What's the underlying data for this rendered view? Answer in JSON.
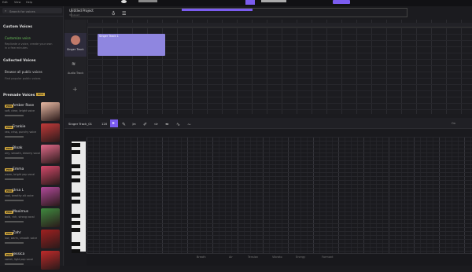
{
  "topbar": {
    "menu_items": [
      "Edit",
      "View",
      "Help"
    ],
    "project_title": "Untitled Project",
    "project_sub": "Unsaved"
  },
  "sidebar": {
    "search_placeholder": "Search for voices",
    "custom_voices": {
      "title": "Custom Voices",
      "item": "Customize voice",
      "desc_lines": [
        "Replicate a voice, create your own",
        "in a few minutes"
      ]
    },
    "collected_voices": {
      "title": "Collected Voices",
      "item": "Browse all public voices",
      "desc": "Find popular public voices"
    },
    "premade_voices": {
      "title": "Premade Voices",
      "badge": "NEW",
      "items": [
        {
          "badge": "PRO",
          "name": "Amber Rose",
          "desc": "soft, clear, bright voice",
          "color": "#e8b9a4"
        },
        {
          "badge": "PRO",
          "name": "Frankie",
          "desc": "raw, crisp, punchy voice",
          "color": "#c23a3a"
        },
        {
          "badge": "PRO",
          "name": "Bloak",
          "desc": "airy, smooth, dreamy vocal",
          "color": "#e06a8a"
        },
        {
          "badge": "PRO",
          "name": "Emma",
          "desc": "warm, bright pop vocal",
          "color": "#d4496b"
        },
        {
          "badge": "PRO",
          "name": "Ursa L",
          "desc": "cool, breathy alt voice",
          "color": "#b04a9a"
        },
        {
          "badge": "PRO",
          "name": "Maximus",
          "desc": "bold, rich, strong vocal",
          "color": "#3f8a3f"
        },
        {
          "badge": "PRO",
          "name": "Zahr",
          "desc": "low, warm, smooth voice",
          "color": "#a02020"
        },
        {
          "badge": "PRO",
          "name": "Jessica",
          "desc": "sweet, light pop vocal",
          "color": "#c02a2a"
        }
      ]
    }
  },
  "tracks": {
    "singer_label": "Singer Track",
    "audio_label": "Audio Track",
    "add_icon": "plus-icon",
    "clip_label": "Singer Track 1"
  },
  "editor": {
    "track_name": "Singer Track_01",
    "tempo": "120",
    "toggle": "On"
  },
  "bottom_labels": [
    "Breath",
    "Air",
    "Tension",
    "Vibrato",
    "Energy",
    "Formant"
  ],
  "colors": {
    "accent": "#7b5cf0",
    "clip": "#8f86e0"
  }
}
